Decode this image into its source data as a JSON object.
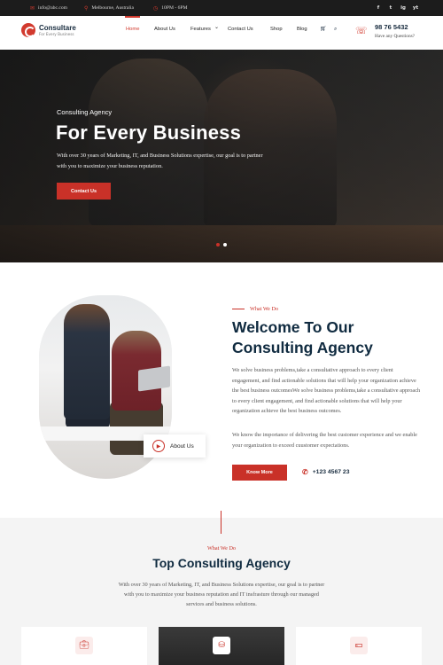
{
  "topbar": {
    "email": "info@abc.com",
    "location": "Melbourne, Australia",
    "hours": "10PM - 6PM",
    "socials": [
      "f",
      "t",
      "ig",
      "yt"
    ]
  },
  "brand": {
    "name": "Consultare",
    "tagline": "For Every Business"
  },
  "nav": {
    "items": [
      "Home",
      "About Us",
      "Features",
      "Contact Us",
      "Shop",
      "Blog"
    ],
    "features_caret": "⌄",
    "phone": "98 76 5432",
    "phone_sub": "Have any Questions?"
  },
  "hero": {
    "kicker": "Consulting Agency",
    "title": "For Every Business",
    "description": "With over 30 years of Marketing, IT, and Business Solutions expertise, our goal is to partner with you to maximize your business reputation.",
    "cta": "Contact Us",
    "slides": 2,
    "active_slide": 1
  },
  "about": {
    "label": "What We Do",
    "title_line1": "Welcome To Our",
    "title_line2": "Consulting Agency",
    "para1": "We solve business problems,take a consultative approach to every client engagement, and find actionable solutions that will help your organization achieve the best business outcomesWe solve business problems,take a consultative approach to every client engagement, and find actionable solutions that will help your organization achieve the best business outcomes.",
    "para2": "We know the importance of delivering the best customer experience and we enable your organization to exceed cuustomer expectations.",
    "badge_label": "About Us",
    "cta": "Know More",
    "phone": "+123 4567 23"
  },
  "services": {
    "label": "What We Do",
    "title": "Top Consulting Agency",
    "description": "With over 30 years of Marketing, IT, and Business Solutions expertise, our goal is to partner with you to maximize your business reputation and IT insfrasture through our managed services and business solutions.",
    "cards": [
      {
        "icon": "briefcase-icon"
      },
      {
        "icon": "coins-icon"
      },
      {
        "icon": "cash-icon"
      }
    ]
  },
  "colors": {
    "accent": "#c93128",
    "navy": "#102b40",
    "topbar": "#1c1c1c"
  }
}
